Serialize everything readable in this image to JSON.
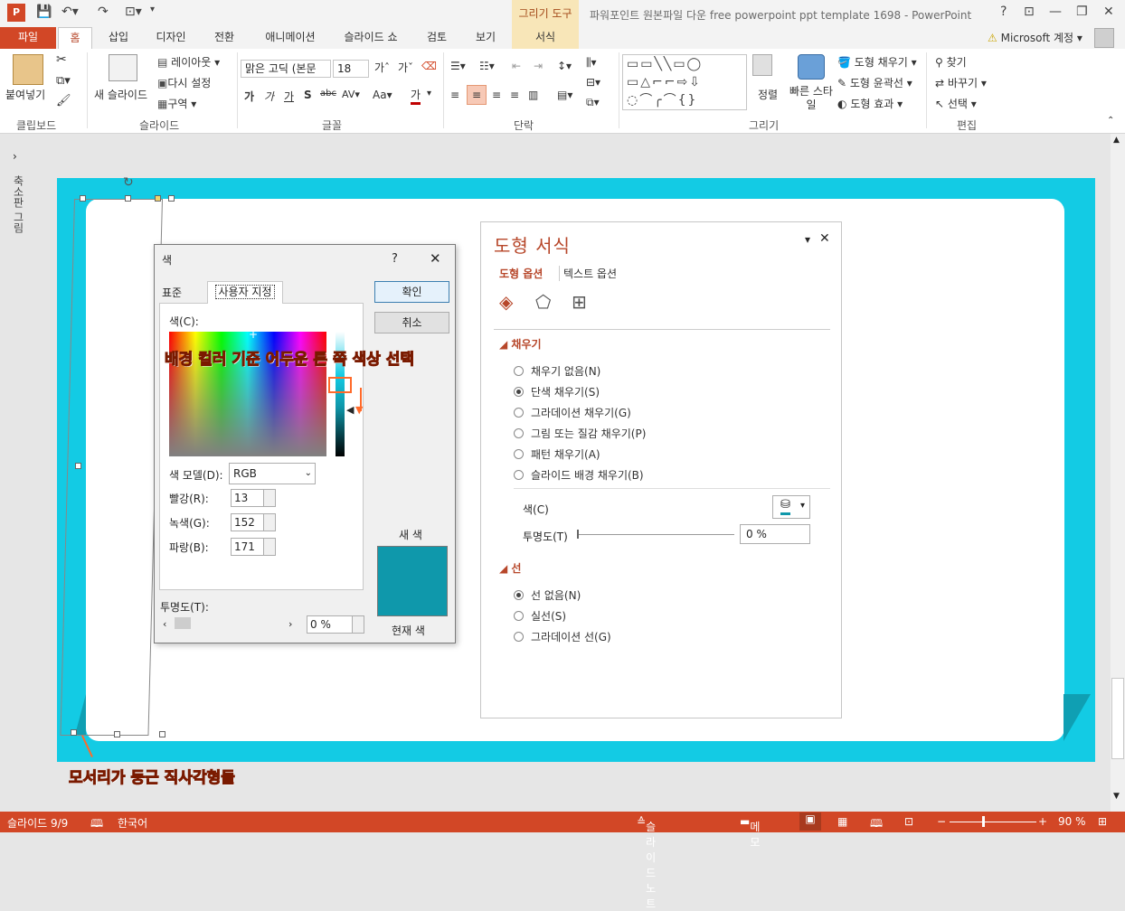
{
  "titlebar": {
    "context_group": "그리기 도구",
    "doc_title": "파워포인트 원본파일 다운 free powerpoint ppt template 1698 - PowerPoint",
    "help": "?",
    "minimize": "—",
    "restore": "❐",
    "close": "✕"
  },
  "tabs": [
    "파일",
    "홈",
    "삽입",
    "디자인",
    "전환",
    "애니메이션",
    "슬라이드 쇼",
    "검토",
    "보기",
    "서식"
  ],
  "account": "Microsoft 계정",
  "ribbon": {
    "clipboard": {
      "paste": "붙여넣기",
      "label": "클립보드"
    },
    "slides": {
      "new_slide": "새 슬라이드",
      "layout": "레이아웃",
      "reset": "다시 설정",
      "section": "구역",
      "label": "슬라이드"
    },
    "font": {
      "font_name": "맑은 고딕 (본문",
      "font_size": "18",
      "label": "글꼴"
    },
    "paragraph": {
      "label": "단락"
    },
    "drawing": {
      "arrange": "정렬",
      "quick_styles": "빠른 스타일",
      "shape_fill": "도형 채우기",
      "shape_outline": "도형 윤곽선",
      "shape_effects": "도형 효과",
      "label": "그리기"
    },
    "editing": {
      "find": "찾기",
      "replace": "바꾸기",
      "select": "선택",
      "label": "편집"
    }
  },
  "left_pane": {
    "label": "축소판 그림"
  },
  "color_dialog": {
    "title": "색",
    "help": "?",
    "tab_standard": "표준",
    "tab_custom": "사용자 지정",
    "colors_label": "색(C):",
    "color_model_label": "색 모델(D):",
    "color_model": "RGB",
    "red_label": "빨강(R):",
    "red": "13",
    "green_label": "녹색(G):",
    "green": "152",
    "blue_label": "파랑(B):",
    "blue": "171",
    "transparency_label": "투명도(T):",
    "transparency": "0 %",
    "ok": "확인",
    "cancel": "취소",
    "new_label": "새 색",
    "current_label": "현재 색",
    "new_color": "#0f98ab"
  },
  "format_panel": {
    "title": "도형 서식",
    "tab_shape": "도형 옵션",
    "tab_text": "텍스트 옵션",
    "fill_section": "채우기",
    "fill_options": [
      "채우기 없음(N)",
      "단색 채우기(S)",
      "그라데이션 채우기(G)",
      "그림 또는 질감 채우기(P)",
      "패턴 채우기(A)",
      "슬라이드 배경 채우기(B)"
    ],
    "fill_selected": 1,
    "color_label": "색(C)",
    "transparency_label": "투명도(T)",
    "transparency": "0 %",
    "line_section": "선",
    "line_options": [
      "선 없음(N)",
      "실선(S)",
      "그라데이션 선(G)"
    ],
    "line_selected": 0
  },
  "annotations": {
    "top": "배경 컬러 기준 어두운 톤 쪽 색상 선택",
    "bottom": "모서리가 둥근 직사각형들"
  },
  "status": {
    "slide": "슬라이드 9/9",
    "lang": "한국어",
    "notes": "슬라이드 노트",
    "comments": "메모",
    "zoom": "90 %"
  },
  "colors": {
    "accent": "#d24726",
    "slide_bg": "#13cbe4",
    "chosen": "#0f98ab"
  }
}
